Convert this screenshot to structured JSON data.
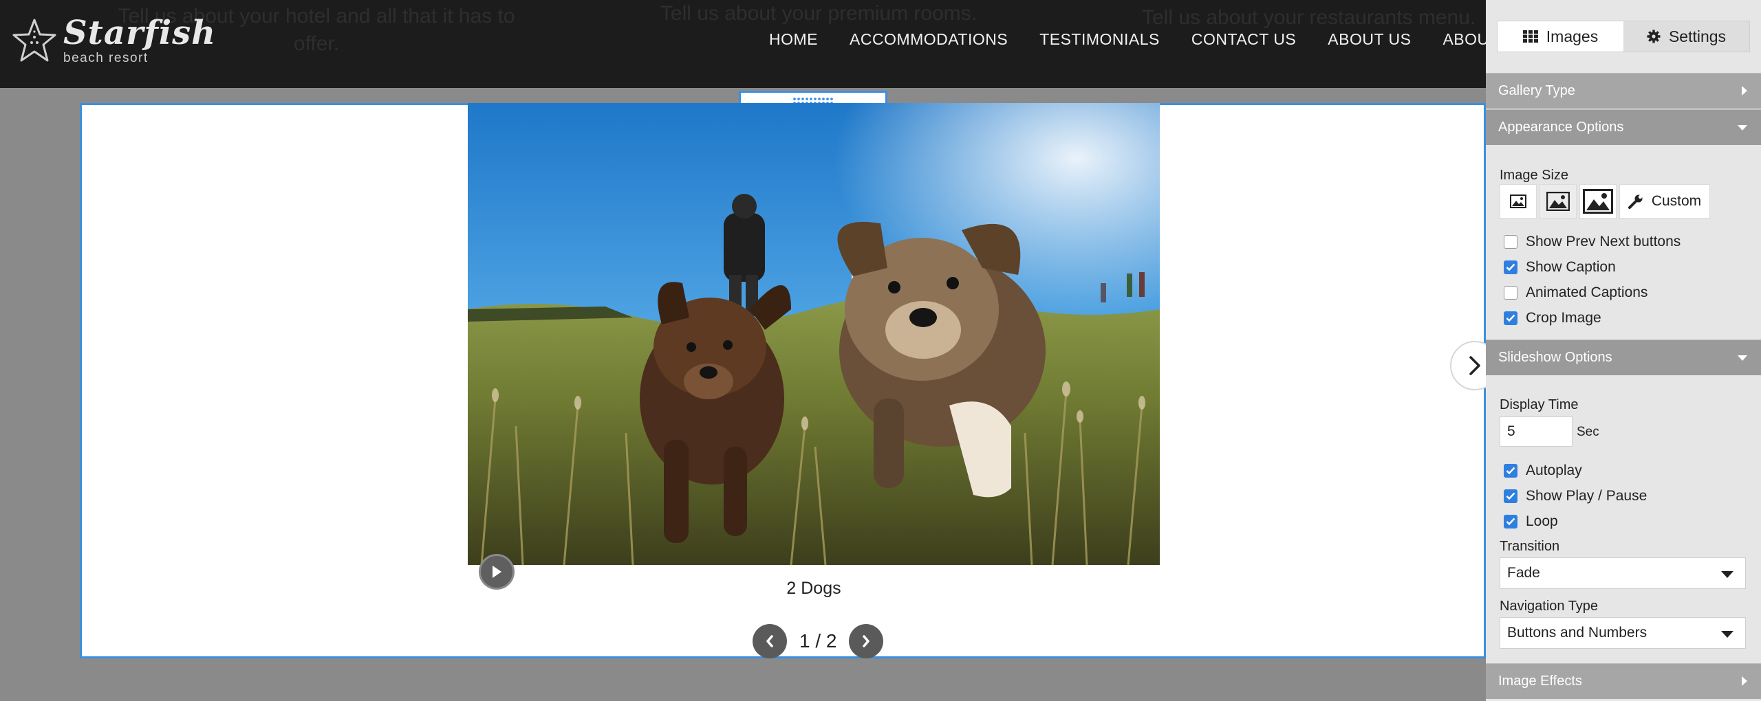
{
  "site": {
    "logo_name": "Starfish",
    "logo_sub": "beach resort",
    "background_texts": [
      "Tell us about your hotel and all that it has to offer.",
      "Tell us about your premium rooms.",
      "Tell us about your restaurants menu."
    ],
    "nav": [
      "HOME",
      "ACCOMMODATIONS",
      "TESTIMONIALS",
      "CONTACT US",
      "ABOUT US",
      "ABOUT US"
    ]
  },
  "gallery": {
    "caption": "2 Dogs",
    "current_page": "1",
    "total_pages": "2",
    "page_indicator": "1 / 2",
    "accent_color": "#3c8fe0"
  },
  "panel": {
    "tabs": [
      {
        "label": "Images",
        "icon": "grid-icon",
        "active": true
      },
      {
        "label": "Settings",
        "icon": "gear-icon",
        "active": false
      }
    ],
    "sections": {
      "gallery_type": "Gallery Type",
      "appearance": "Appearance Options",
      "slideshow": "Slideshow Options",
      "effects": "Image Effects"
    },
    "appearance": {
      "image_size_label": "Image Size",
      "custom_label": "Custom",
      "options": [
        {
          "label": "Show Prev Next buttons",
          "checked": false
        },
        {
          "label": "Show Caption",
          "checked": true
        },
        {
          "label": "Animated Captions",
          "checked": false
        },
        {
          "label": "Crop Image",
          "checked": true
        }
      ]
    },
    "slideshow": {
      "display_time_label": "Display Time",
      "display_time_value": "5",
      "unit": "Sec",
      "options": [
        {
          "label": "Autoplay",
          "checked": true
        },
        {
          "label": "Show Play / Pause",
          "checked": true
        },
        {
          "label": "Loop",
          "checked": true
        }
      ],
      "transition_label": "Transition",
      "transition_value": "Fade",
      "navigation_label": "Navigation Type",
      "navigation_value": "Buttons and Numbers"
    }
  }
}
